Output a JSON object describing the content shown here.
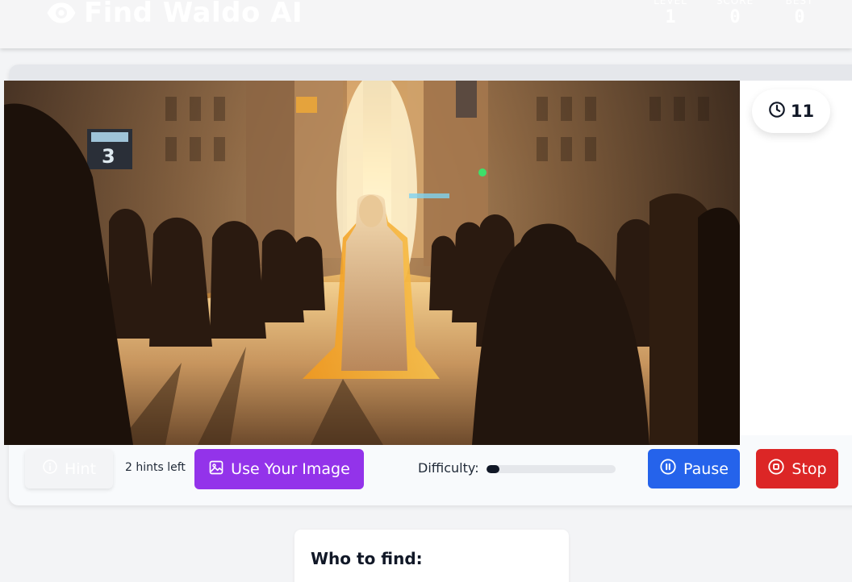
{
  "header": {
    "title": "Find Waldo AI",
    "logo_icon": "eye-icon",
    "stats": [
      {
        "label": "LEVEL",
        "value": "1"
      },
      {
        "label": "SCORE",
        "value": "0"
      },
      {
        "label": "BEST",
        "value": "0"
      }
    ]
  },
  "timer": {
    "icon": "clock-icon",
    "value": "11"
  },
  "controls": {
    "hint_label": "Hint",
    "hint_icon": "info-icon",
    "hints_left": "2 hints left",
    "upload_label": "Use Your Image",
    "upload_icon": "image-icon",
    "difficulty_label": "Difficulty:",
    "difficulty_level": 0.1,
    "pause_label": "Pause",
    "pause_icon": "pause-circle-icon",
    "stop_label": "Stop",
    "stop_icon": "stop-circle-icon"
  },
  "scene": {
    "sign_number": "3"
  },
  "target": {
    "title": "Who to find:"
  },
  "colors": {
    "purple": "#9333ea",
    "blue": "#2563eb",
    "red": "#dc2626",
    "dark": "#111827"
  }
}
